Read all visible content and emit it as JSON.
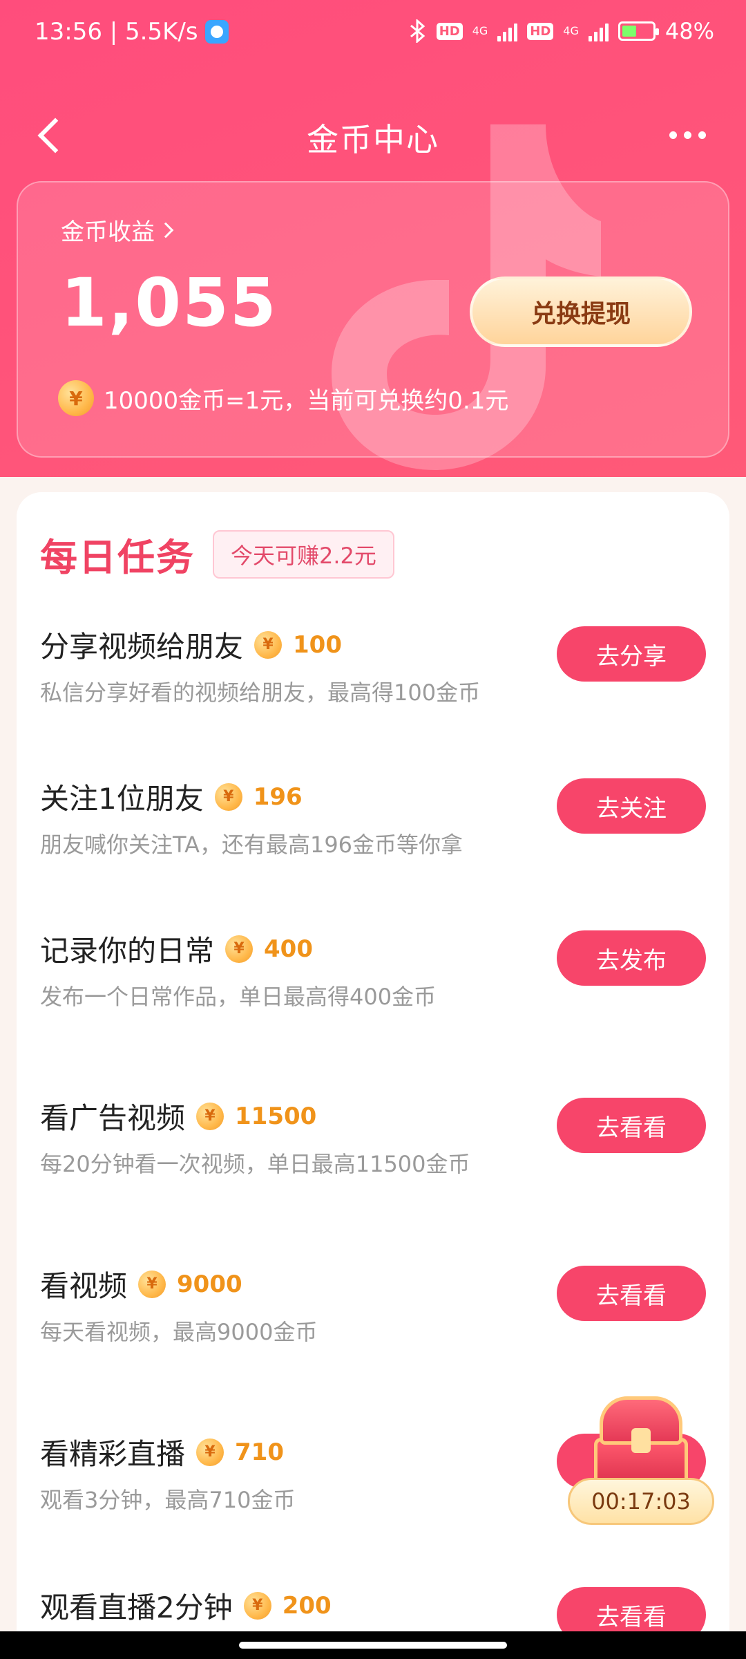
{
  "status_bar": {
    "time_speed": "13:56 | 5.5K/s",
    "network1": "4G",
    "network2": "4G",
    "hd1": "HD",
    "hd2": "HD",
    "battery": "48%"
  },
  "nav": {
    "title": "金币中心"
  },
  "balance": {
    "label": "金币收益",
    "amount": "1,055",
    "exchange_button": "兑换提现",
    "rate_text": "10000金币=1元，当前可兑换约0.1元",
    "coin_symbol": "¥"
  },
  "daily_tasks": {
    "title": "每日任务",
    "badge": "今天可赚2.2元",
    "items": [
      {
        "title": "分享视频给朋友",
        "reward": "100",
        "desc": "私信分享好看的视频给朋友，最高得100金币",
        "button": "去分享"
      },
      {
        "title": "关注1位朋友",
        "reward": "196",
        "desc": "朋友喊你关注TA，还有最高196金币等你拿",
        "button": "去关注"
      },
      {
        "title": "记录你的日常",
        "reward": "400",
        "desc": "发布一个日常作品，单日最高得400金币",
        "button": "去发布"
      },
      {
        "title": "看广告视频",
        "reward": "11500",
        "desc": "每20分钟看一次视频，单日最高11500金币",
        "button": "去看看"
      },
      {
        "title": "看视频",
        "reward": "9000",
        "desc": "每天看视频，最高9000金币",
        "button": "去看看"
      },
      {
        "title": "看精彩直播",
        "reward": "710",
        "desc": "观看3分钟，最高710金币",
        "button": "去看看"
      },
      {
        "title": "观看直播2分钟",
        "reward": "200",
        "desc": "",
        "button": "去看看"
      }
    ]
  },
  "chest": {
    "timer": "00:17:03"
  },
  "colors": {
    "accent": "#f7456a",
    "reward": "#f0931a",
    "title_red": "#f04363"
  }
}
